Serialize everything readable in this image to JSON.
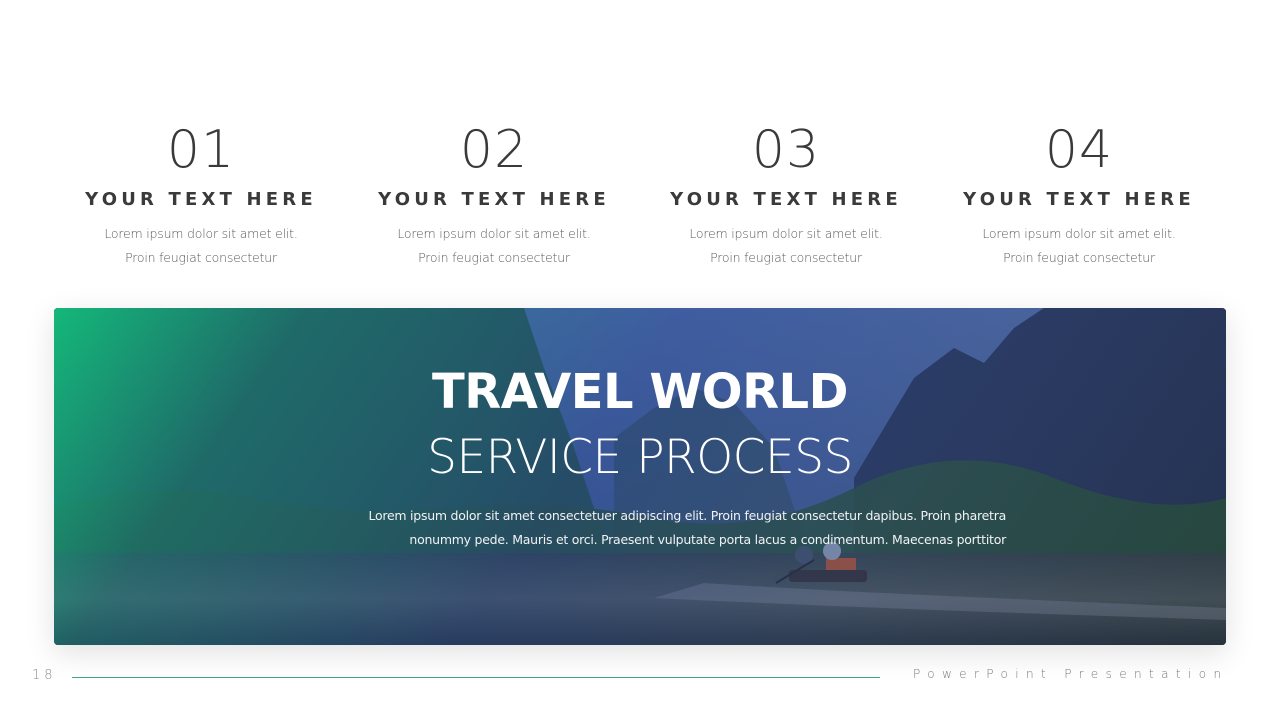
{
  "steps": [
    {
      "number": "01",
      "title": "YOUR TEXT HERE",
      "line1": "Lorem ipsum dolor sit amet elit.",
      "line2": "Proin feugiat consectetur"
    },
    {
      "number": "02",
      "title": "YOUR TEXT HERE",
      "line1": "Lorem ipsum dolor sit amet elit.",
      "line2": "Proin feugiat consectetur"
    },
    {
      "number": "03",
      "title": "YOUR TEXT HERE",
      "line1": "Lorem ipsum dolor sit amet elit.",
      "line2": "Proin feugiat consectetur"
    },
    {
      "number": "04",
      "title": "YOUR TEXT HERE",
      "line1": "Lorem ipsum dolor sit amet elit.",
      "line2": "Proin feugiat consectetur"
    }
  ],
  "banner": {
    "title_bold": "TRAVEL WORLD",
    "title_light": "SERVICE PROCESS",
    "desc_line1": "Lorem ipsum dolor sit amet consectetuer adipiscing elit. Proin feugiat consectetur dapibus. Proin pharetra",
    "desc_line2": "nonummy pede. Mauris et orci. Praesent vulputate porta lacus a condimentum. Maecenas porttitor",
    "image": "river-karst-mountains-boat-photo"
  },
  "footer": {
    "page_number": "18",
    "title": "PowerPoint Presentation",
    "accent_color": "#3aa87e"
  },
  "colors": {
    "heading": "#3a3a3a",
    "gradient_start": "#10c882",
    "gradient_end": "#1e3c8c"
  }
}
